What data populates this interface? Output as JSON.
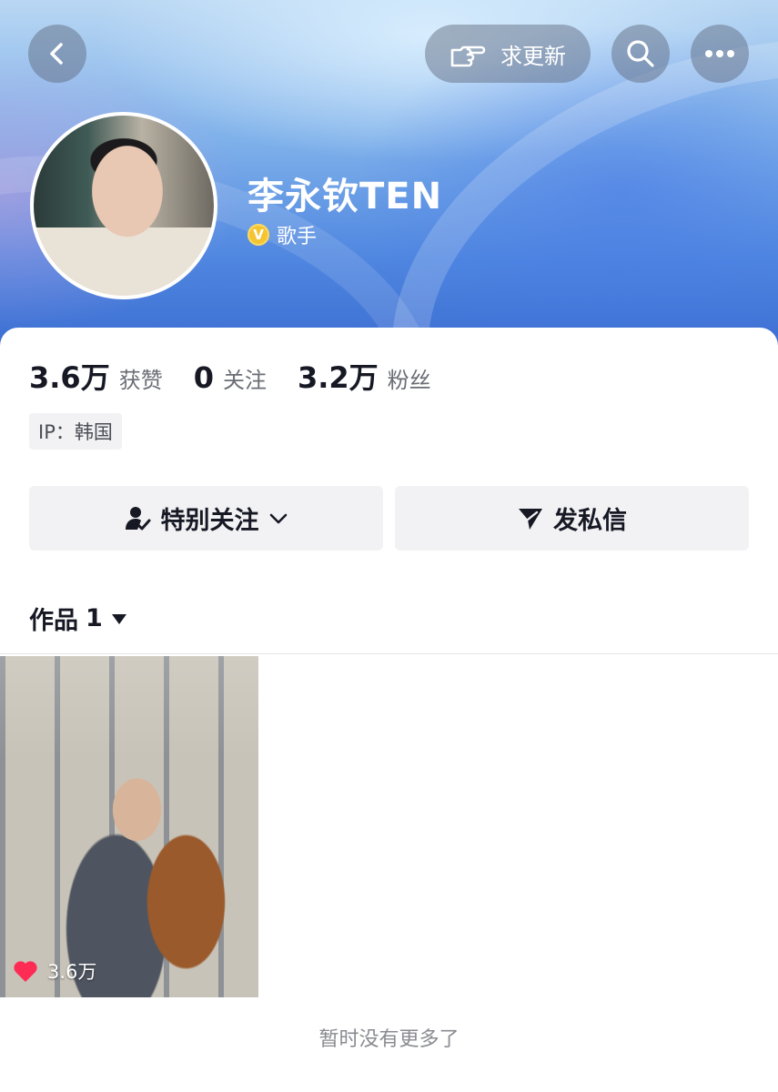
{
  "header": {
    "update_request_label": "求更新",
    "name": "李永钦TEN",
    "verified_badge_letter": "V",
    "verified_title": "歌手"
  },
  "stats": [
    {
      "value": "3.6万",
      "label": "获赞"
    },
    {
      "value": "0",
      "label": "关注"
    },
    {
      "value": "3.2万",
      "label": "粉丝"
    }
  ],
  "ip_location": "IP：韩国",
  "actions": {
    "special_follow_label": "特别关注",
    "message_label": "发私信"
  },
  "works_tab": {
    "label": "作品",
    "count": "1"
  },
  "videos": [
    {
      "likes": "3.6万"
    }
  ],
  "footer_text": "暂时没有更多了",
  "colors": {
    "like_heart": "#fe2c55",
    "verified_gold": "#f5c531",
    "button_bg": "#f2f2f4"
  }
}
